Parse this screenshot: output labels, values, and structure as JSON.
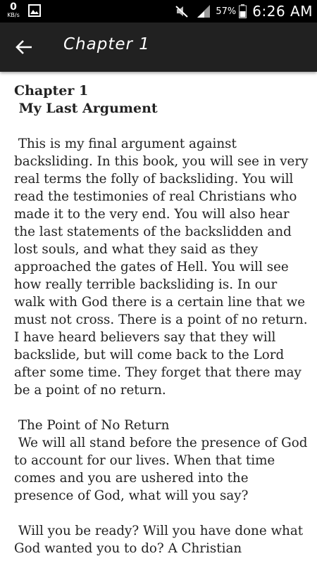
{
  "status_bar": {
    "network_speed_value": "0",
    "network_speed_unit": "KB/s",
    "battery_percent": "57%",
    "time": "6:26 AM",
    "icons": [
      "image-icon",
      "mute-icon",
      "signal-icon",
      "battery-icon"
    ]
  },
  "app_bar": {
    "back_icon": "arrow-left-icon",
    "title": "Chapter 1"
  },
  "content": {
    "chapter_heading": "Chapter 1",
    "chapter_subtitle": " My Last Argument",
    "paragraph_1": " This is my final argument against backsliding. In this book, you will see in very real terms the folly of backsliding. You will read the testimonies of real Christians who made it to the very end. You will also hear the last statements of the backslidden and lost souls, and what they said as they approached the gates of Hell. You will see how really terrible backsliding is. In our walk with God there is a certain line that we must not cross. There is a point of no return. I have heard believers say that they will backslide, but will come back to the Lord after some time. They forget that there may be a point of no return.",
    "section_heading": " The Point of No Return",
    "paragraph_2": " We will all stand before the presence of God to account for our lives. When that time comes and you are ushered into the presence of God, what will you say?",
    "paragraph_3": " Will you be ready? Will you have done what God wanted you to do? A Christian"
  },
  "colors": {
    "status_bar_bg": "#000000",
    "app_bar_bg": "#212121",
    "page_bg": "#ffffff",
    "text": "#222222"
  }
}
